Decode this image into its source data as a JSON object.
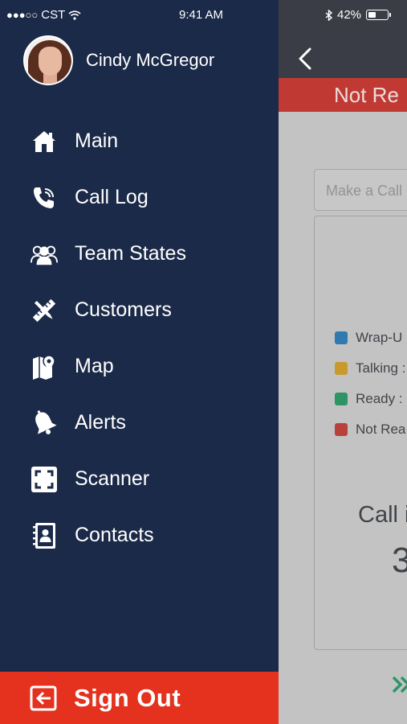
{
  "status_bar": {
    "carrier": "CST",
    "time": "9:41 AM",
    "battery_percent": "42%",
    "battery_level": 0.42
  },
  "profile": {
    "name": "Cindy McGregor"
  },
  "menu": {
    "items": [
      {
        "label": "Main",
        "icon": "home-icon"
      },
      {
        "label": "Call Log",
        "icon": "phone-call-icon"
      },
      {
        "label": "Team States",
        "icon": "team-icon"
      },
      {
        "label": "Customers",
        "icon": "tools-icon"
      },
      {
        "label": "Map",
        "icon": "map-pin-icon"
      },
      {
        "label": "Alerts",
        "icon": "bell-icon"
      },
      {
        "label": "Scanner",
        "icon": "scanner-icon"
      },
      {
        "label": "Contacts",
        "icon": "address-book-icon"
      }
    ],
    "signout_label": "Sign Out"
  },
  "background_app": {
    "status_banner": "Not Re",
    "call_input_placeholder": "Make a Call",
    "legend": [
      {
        "label": "Wrap-U",
        "color": "#2f7ab0"
      },
      {
        "label": "Talking :",
        "color": "#c89a2e"
      },
      {
        "label": "Ready :",
        "color": "#2e9468"
      },
      {
        "label": "Not Rea",
        "color": "#b8423b"
      }
    ],
    "call_label": "Call i",
    "call_value": "3"
  },
  "colors": {
    "menu_bg": "#1b2a48",
    "signout_bg": "#e4321e",
    "banner_bg": "#c03a33"
  }
}
